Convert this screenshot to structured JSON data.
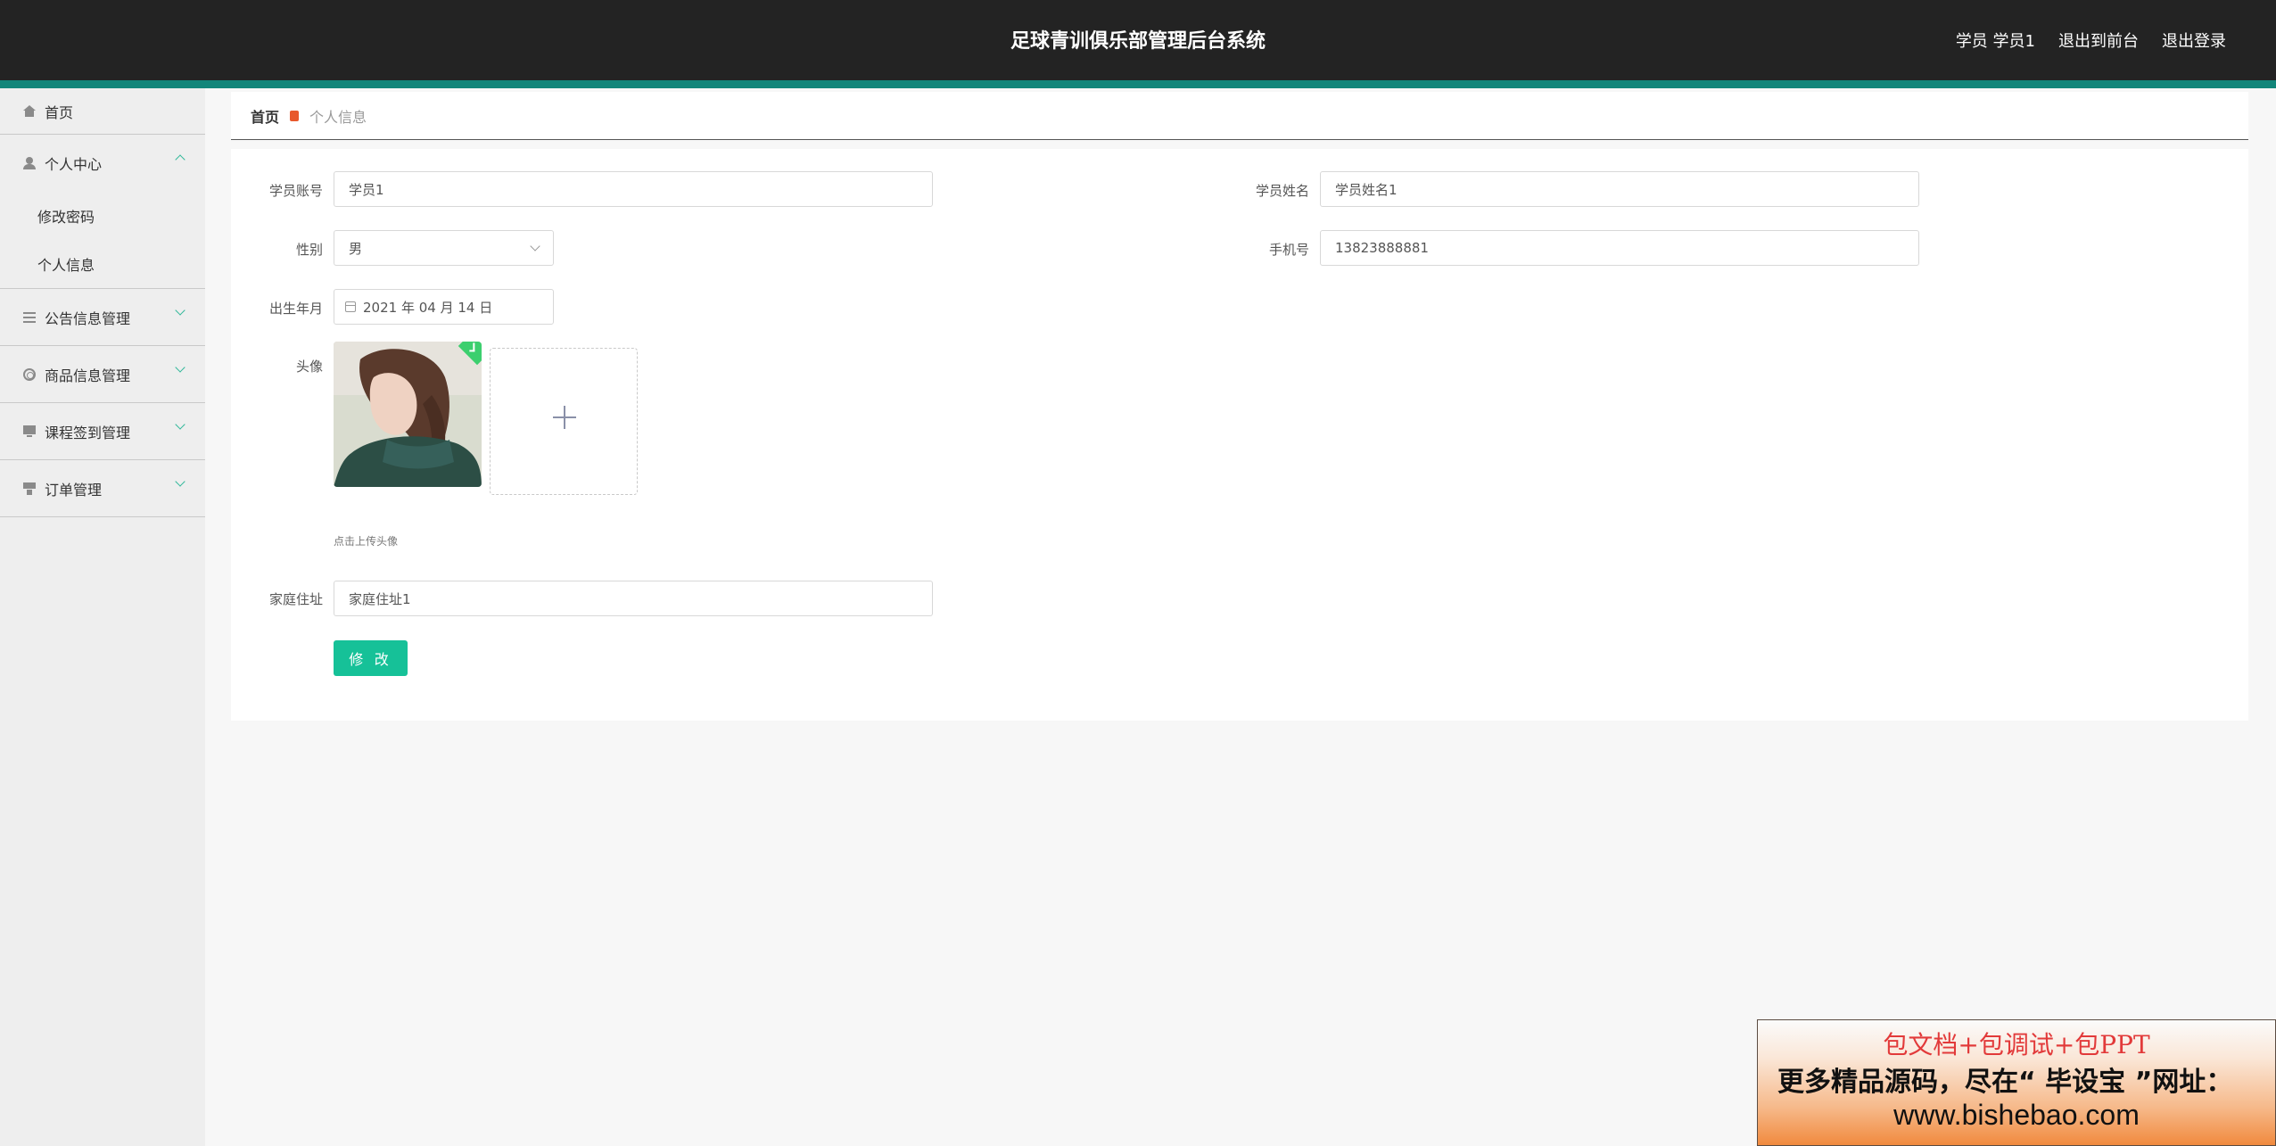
{
  "header": {
    "title": "足球青训俱乐部管理后台系统",
    "user_label": "学员 学员1",
    "front_link": "退出到前台",
    "logout_link": "退出登录"
  },
  "sidebar": {
    "home": "首页",
    "groups": [
      {
        "label": "个人中心",
        "icon": "user-icon",
        "expanded": true,
        "items": [
          "修改密码",
          "个人信息"
        ]
      },
      {
        "label": "公告信息管理",
        "icon": "list-icon",
        "expanded": false
      },
      {
        "label": "商品信息管理",
        "icon": "ring-icon",
        "expanded": false
      },
      {
        "label": "课程签到管理",
        "icon": "monitor-icon",
        "expanded": false
      },
      {
        "label": "订单管理",
        "icon": "stamp-icon",
        "expanded": false
      }
    ]
  },
  "breadcrumb": {
    "home": "首页",
    "current": "个人信息"
  },
  "form": {
    "account": {
      "label": "学员账号",
      "value": "学员1"
    },
    "name": {
      "label": "学员姓名",
      "value": "学员姓名1"
    },
    "gender": {
      "label": "性别",
      "value": "男"
    },
    "phone": {
      "label": "手机号",
      "value": "13823888881"
    },
    "birth": {
      "label": "出生年月",
      "value": "2021 年 04 月 14 日"
    },
    "avatar": {
      "label": "头像",
      "hint": "点击上传头像"
    },
    "address": {
      "label": "家庭住址",
      "value": "家庭住址1"
    },
    "submit": "修 改"
  },
  "ad": {
    "line1": "包文档+包调试+包PPT",
    "line2": "更多精品源码，尽在“ 毕设宝 ”网址：",
    "line3": "www.bishebao.com"
  },
  "colors": {
    "header_bg": "#232323",
    "accent": "#13867a",
    "button": "#16c198",
    "breadcrumb_marker": "#e8582c"
  }
}
